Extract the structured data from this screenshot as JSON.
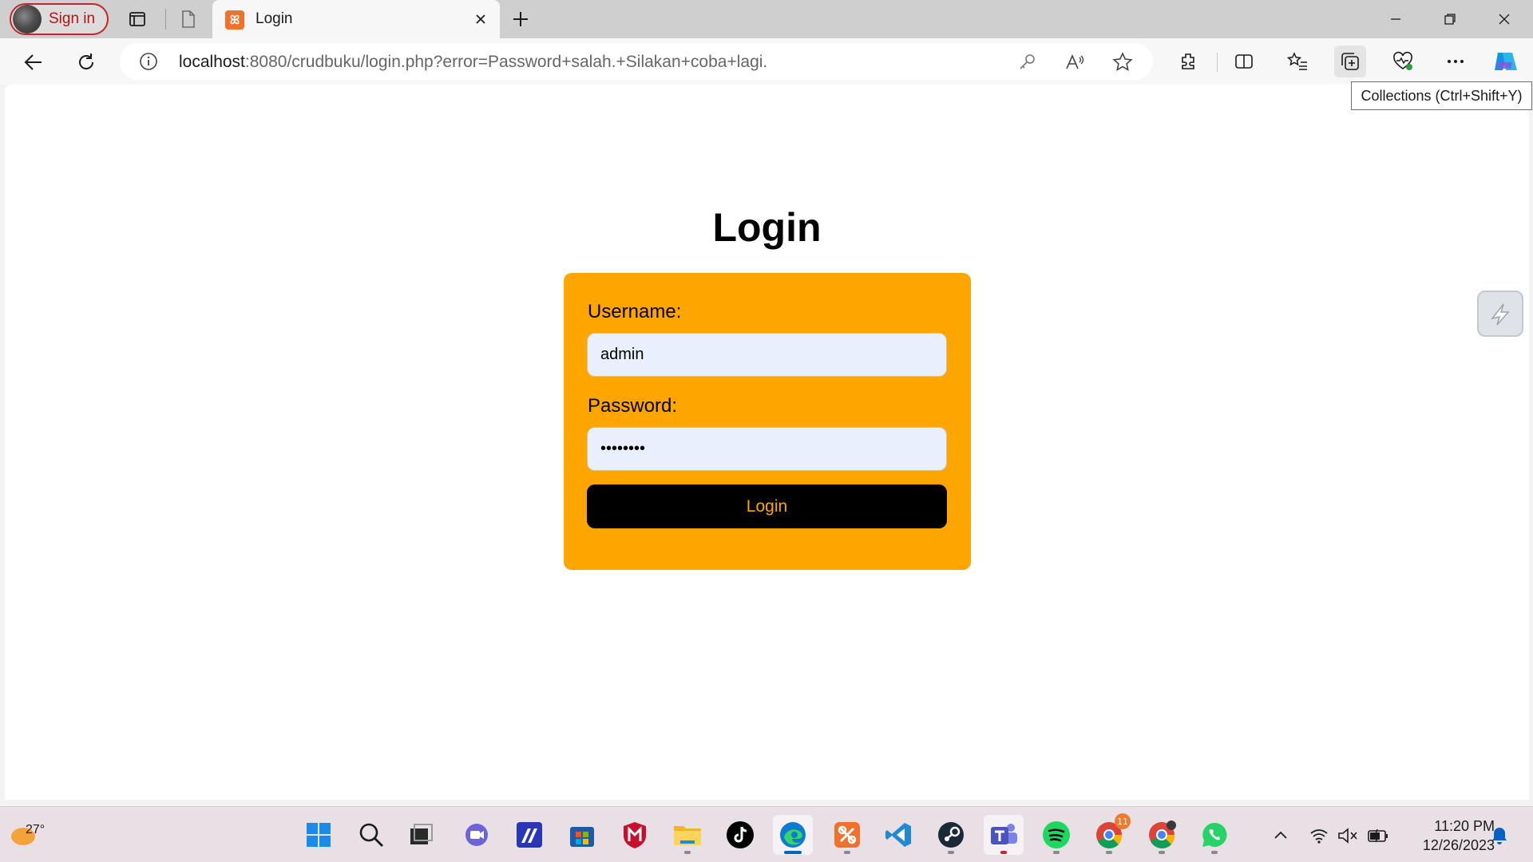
{
  "browser": {
    "profile_label": "Sign in",
    "tab": {
      "title": "Login"
    },
    "address": {
      "host": "localhost",
      "rest": ":8080/crudbuku/login.php?error=Password+salah.+Silakan+coba+lagi."
    },
    "tooltip": "Collections (Ctrl+Shift+Y)"
  },
  "page": {
    "heading": "Login",
    "form": {
      "username_label": "Username:",
      "username_value": "admin",
      "password_label": "Password:",
      "password_value": "••••••••",
      "submit_label": "Login"
    }
  },
  "taskbar": {
    "weather_temp": "27°",
    "chrome_badge": "11",
    "time": "11:20 PM",
    "date": "12/26/2023"
  },
  "colors": {
    "card": "#ffa500",
    "button": "#000000",
    "button_text": "#ffa500",
    "input_bg": "#e8f0fe",
    "signin_accent": "#c4242b"
  }
}
